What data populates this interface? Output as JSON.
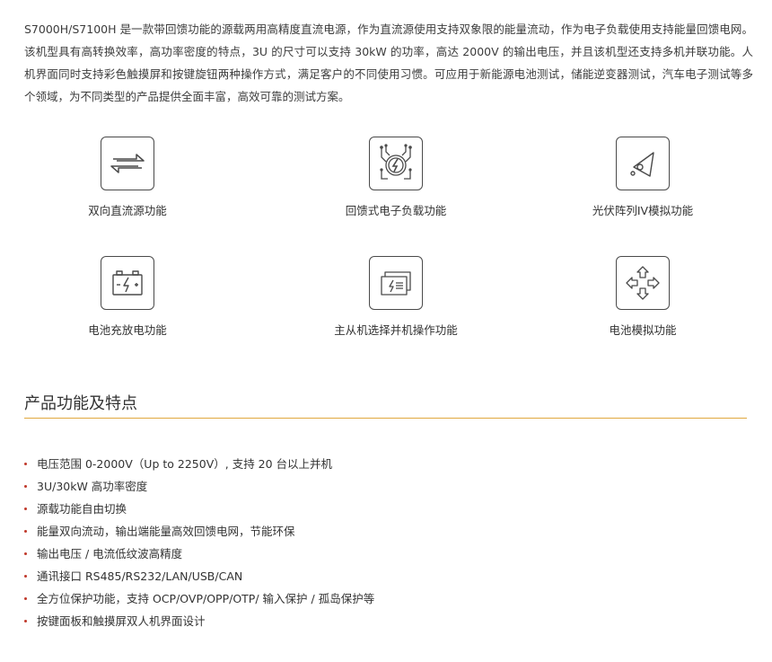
{
  "intro": "S7000H/S7100H 是一款带回馈功能的源载两用高精度直流电源，作为直流源使用支持双象限的能量流动，作为电子负载使用支持能量回馈电网。该机型具有高转换效率，高功率密度的特点，3U 的尺寸可以支持 30kW 的功率，高达 2000V 的输出电压，并且该机型还支持多机并联功能。人机界面同时支持彩色触摸屏和按键旋钮两种操作方式，满足客户的不同使用习惯。可应用于新能源电池测试，储能逆变器测试，汽车电子测试等多个领域，为不同类型的产品提供全面丰富，高效可靠的测试方案。",
  "features": [
    {
      "label": "双向直流源功能",
      "icon": "bidirectional-arrows-icon"
    },
    {
      "label": "回馈式电子负载功能",
      "icon": "feedback-load-icon"
    },
    {
      "label": "光伏阵列IV模拟功能",
      "icon": "pv-iv-icon"
    },
    {
      "label": "电池充放电功能",
      "icon": "battery-icon"
    },
    {
      "label": "主从机选择并机操作功能",
      "icon": "parallel-units-icon"
    },
    {
      "label": "电池模拟功能",
      "icon": "four-arrows-icon"
    }
  ],
  "section": {
    "title": "产品功能及特点"
  },
  "bullets": [
    "电压范围 0-2000V（Up to 2250V）, 支持 20 台以上并机",
    "3U/30kW 高功率密度",
    "源载功能自由切换",
    "能量双向流动，输出端能量高效回馈电网，节能环保",
    "输出电压 / 电流低纹波高精度",
    "通讯接口 RS485/RS232/LAN/USB/CAN",
    "全方位保护功能，支持 OCP/OVP/OPP/OTP/ 输入保护 / 孤岛保护等",
    "按键面板和触摸屏双人机界面设计"
  ],
  "colors": {
    "accent_rule": "#e0a83e",
    "bullet_dot": "#c0392b",
    "icon_stroke": "#4a4a4a"
  }
}
